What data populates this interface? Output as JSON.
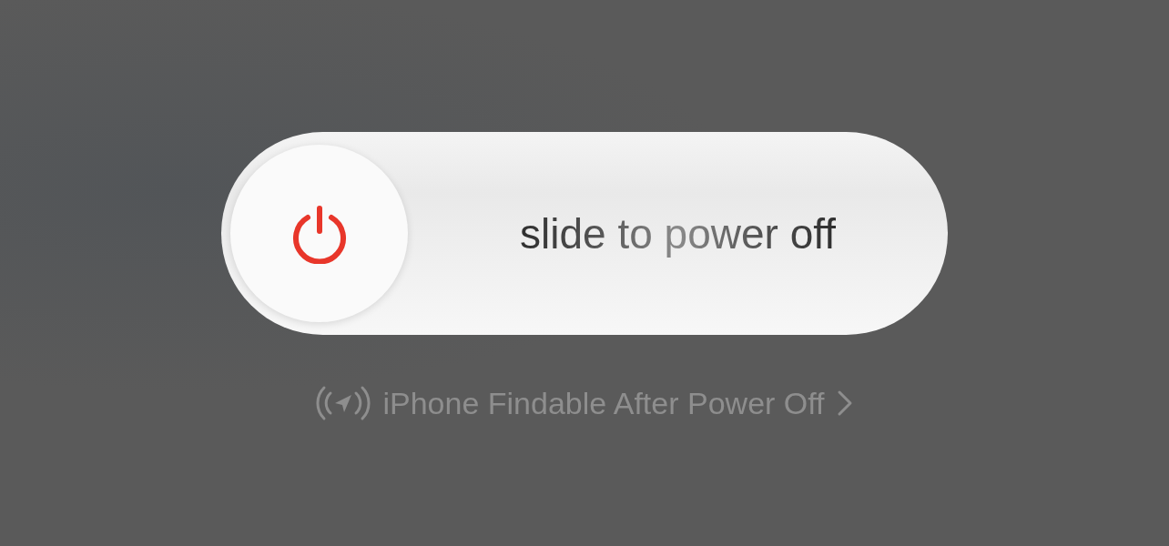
{
  "slider": {
    "label": "slide to power off",
    "level": 0
  },
  "findable_link": {
    "label": "iPhone Findable After Power Off"
  }
}
